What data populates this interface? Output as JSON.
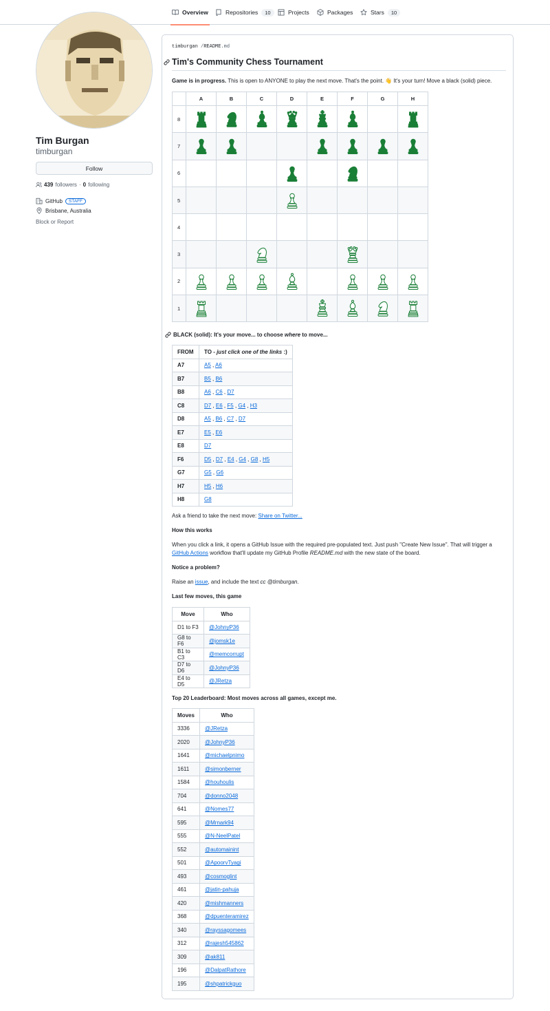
{
  "nav": {
    "tabs": [
      {
        "label": "Overview",
        "icon": "book-icon"
      },
      {
        "label": "Repositories",
        "icon": "repo-icon",
        "count": "10"
      },
      {
        "label": "Projects",
        "icon": "table-icon"
      },
      {
        "label": "Packages",
        "icon": "package-icon"
      },
      {
        "label": "Stars",
        "icon": "star-icon",
        "count": "10"
      }
    ]
  },
  "profile": {
    "name": "Tim Burgan",
    "username": "timburgan",
    "follow_label": "Follow",
    "followers": "439",
    "followers_label": "followers",
    "dot": "·",
    "following": "0",
    "following_label": "following",
    "org": "GitHub",
    "staff_badge": "STAFF",
    "location": "Brisbane, Australia",
    "block_label": "Block or Report"
  },
  "readme": {
    "path_user": "timburgan",
    "path_sep": "/",
    "path_file": "README",
    "path_ext": ".md",
    "title": "Tim's Community Chess Tournament",
    "intro_bold": "Game is in progress.",
    "intro_text": " This is open to ANYONE to play the next move. That's the point. 👋 It's your turn! Move a black (solid) piece.",
    "board": {
      "files": [
        "A",
        "B",
        "C",
        "D",
        "E",
        "F",
        "G",
        "H"
      ],
      "ranks": [
        {
          "rank": "8",
          "squares": [
            "br",
            "bn",
            "bb",
            "bq",
            "bk",
            "bb",
            "",
            "br"
          ]
        },
        {
          "rank": "7",
          "squares": [
            "bp",
            "bp",
            "",
            "",
            "bp",
            "bp",
            "bp",
            "bp"
          ]
        },
        {
          "rank": "6",
          "squares": [
            "",
            "",
            "",
            "bp",
            "",
            "bn",
            "",
            ""
          ]
        },
        {
          "rank": "5",
          "squares": [
            "",
            "",
            "",
            "wp",
            "",
            "",
            "",
            ""
          ]
        },
        {
          "rank": "4",
          "squares": [
            "",
            "",
            "",
            "",
            "",
            "",
            "",
            ""
          ]
        },
        {
          "rank": "3",
          "squares": [
            "",
            "",
            "wn",
            "",
            "",
            "wq",
            "",
            ""
          ]
        },
        {
          "rank": "2",
          "squares": [
            "wp",
            "wp",
            "wp",
            "wb",
            "",
            "wp",
            "wp",
            "wp"
          ]
        },
        {
          "rank": "1",
          "squares": [
            "wr",
            "",
            "",
            "",
            "wk",
            "wb",
            "wn",
            "wr"
          ]
        }
      ]
    },
    "moves_heading_prefix": "BLACK (solid): It's your move... to choose ",
    "moves_heading_em": "where",
    "moves_heading_suffix": " to move...",
    "moves_table": {
      "col_from": "FROM",
      "col_to_prefix": "TO - ",
      "col_to_em": "just click one of the links",
      "col_to_suffix": " :)",
      "rows": [
        {
          "from": "A7",
          "to": [
            "A5",
            "A6"
          ]
        },
        {
          "from": "B7",
          "to": [
            "B5",
            "B6"
          ]
        },
        {
          "from": "B8",
          "to": [
            "A6",
            "C6",
            "D7"
          ]
        },
        {
          "from": "C8",
          "to": [
            "D7",
            "E6",
            "F5",
            "G4",
            "H3"
          ]
        },
        {
          "from": "D8",
          "to": [
            "A5",
            "B6",
            "C7",
            "D7"
          ]
        },
        {
          "from": "E7",
          "to": [
            "E5",
            "E6"
          ]
        },
        {
          "from": "E8",
          "to": [
            "D7"
          ]
        },
        {
          "from": "F6",
          "to": [
            "D5",
            "D7",
            "E4",
            "G4",
            "G8",
            "H5"
          ]
        },
        {
          "from": "G7",
          "to": [
            "G5",
            "G6"
          ]
        },
        {
          "from": "H7",
          "to": [
            "H5",
            "H6"
          ]
        },
        {
          "from": "H8",
          "to": [
            "G8"
          ]
        }
      ]
    },
    "share_prefix": "Ask a friend to take the next move: ",
    "share_link": "Share on Twitter...",
    "how_heading": "How this works",
    "how_text_1": "When you click a link, it opens a GitHub Issue with the required pre-populated text. Just push \"Create New Issue\". That will trigger a",
    "how_link": "GitHub Actions",
    "how_text_2": " workflow that'll update my GitHub Profile ",
    "how_em": "README.md",
    "how_text_3": " with the new state of the board.",
    "notice_heading": "Notice a problem?",
    "notice_prefix": "Raise an ",
    "notice_link": "issue",
    "notice_mid": ", and include the text ",
    "notice_em": "cc @timburgan",
    "notice_suffix": ".",
    "last_heading": "Last few moves, this game",
    "last_table": {
      "col_move": "Move",
      "col_who": "Who",
      "rows": [
        {
          "move": "D1 to F3",
          "who": "@JohnyP36"
        },
        {
          "move": "G8 to F6",
          "who": "@jomsk1e"
        },
        {
          "move": "B1 to C3",
          "who": "@memcorrupt"
        },
        {
          "move": "D7 to D6",
          "who": "@JohnyP36"
        },
        {
          "move": "E4 to D5",
          "who": "@JRetza"
        }
      ]
    },
    "leader_heading": "Top 20 Leaderboard: Most moves across all games, except me.",
    "leader_table": {
      "col_moves": "Moves",
      "col_who": "Who",
      "rows": [
        {
          "moves": "3336",
          "who": "@JRetza"
        },
        {
          "moves": "2020",
          "who": "@JohnyP36"
        },
        {
          "moves": "1641",
          "who": "@michaelpnimo"
        },
        {
          "moves": "1611",
          "who": "@simonberner"
        },
        {
          "moves": "1584",
          "who": "@houhoulis"
        },
        {
          "moves": "704",
          "who": "@donno2048"
        },
        {
          "moves": "641",
          "who": "@Nomes77"
        },
        {
          "moves": "595",
          "who": "@Mrnark94"
        },
        {
          "moves": "555",
          "who": "@N-NeelPatel"
        },
        {
          "moves": "552",
          "who": "@automainint"
        },
        {
          "moves": "501",
          "who": "@ApoorvTyagi"
        },
        {
          "moves": "493",
          "who": "@cosmoglint"
        },
        {
          "moves": "461",
          "who": "@jatin-pahuja"
        },
        {
          "moves": "420",
          "who": "@mishmanners"
        },
        {
          "moves": "368",
          "who": "@dpuenteramirez"
        },
        {
          "moves": "340",
          "who": "@rayssagomees"
        },
        {
          "moves": "312",
          "who": "@rajesh545862"
        },
        {
          "moves": "309",
          "who": "@ak811"
        },
        {
          "moves": "196",
          "who": "@DalpatRathore"
        },
        {
          "moves": "195",
          "who": "@shpatrickguo"
        }
      ]
    }
  },
  "colors": {
    "piece_green": "#1a7f37",
    "link": "#0969da",
    "border": "#d0d7de",
    "active_tab_underline": "#fd8c73"
  }
}
